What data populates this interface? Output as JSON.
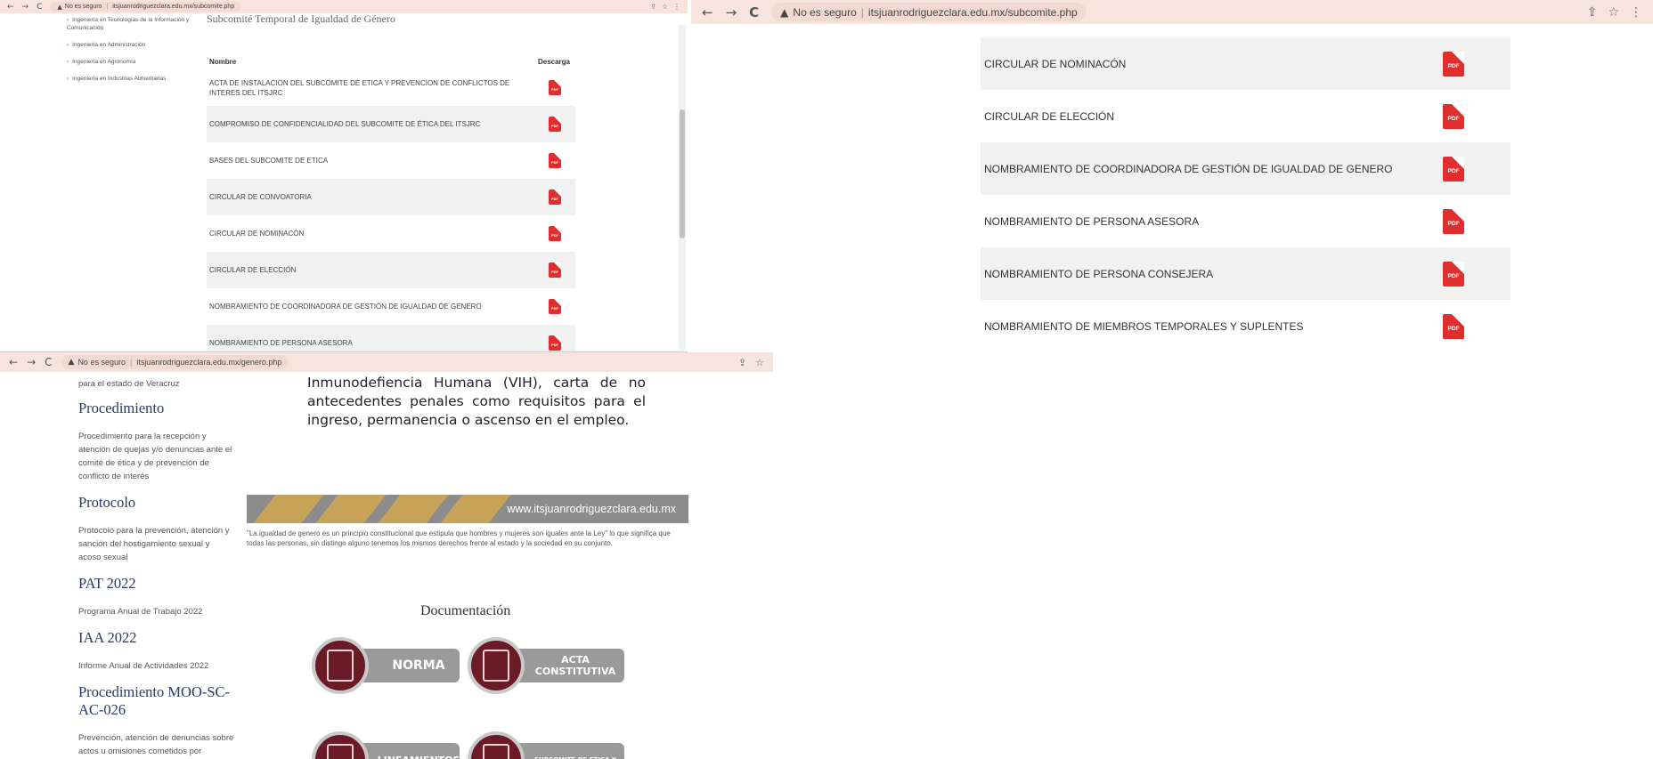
{
  "winA": {
    "url_warning": "No es seguro",
    "url": "itsjuanrodriguezclara.edu.mx/subcomite.php",
    "heading_partial": "Subcomité Temporal de Igualdad de Género",
    "sidebar": [
      "Ingeniería en Tecnologías de la Información y Comunicación",
      "Ingeniería en Administración",
      "Ingeniería en Agronomía",
      "Ingeniería en Industrias Alimentarias"
    ],
    "table": {
      "col_name": "Nombre",
      "col_download": "Descarga",
      "rows": [
        "ACTA DE INSTALACION DEL SUBCOMITE DE ETICA Y PREVENCION DE CONFLICTOS DE INTERES DEL ITSJRC",
        "COMPROMISO DE CONFIDENCIALIDAD DEL SUBCOMITE DE ÉTICA DEL ITSJRC",
        "BASES DEL SUBCOMITE DE ETICA",
        "CIRCULAR DE CONVOATORIA",
        "CIRCULAR DE NOMINACÓN",
        "CIRCULAR DE ELECCIÓN",
        "NOMBRAMIENTO DE COORDINADORA DE GESTIÓN DE IGUALDAD DE GENERO",
        "NOMBRAMIENTO DE PERSONA ASESORA"
      ]
    }
  },
  "winB": {
    "url_warning": "No es seguro",
    "url": "itsjuanrodriguezclara.edu.mx/subcomite.php",
    "rows": [
      "CIRCULAR DE NOMINACÓN",
      "CIRCULAR DE ELECCIÓN",
      "NOMBRAMIENTO DE COORDINADORA DE GESTIÓN DE IGUALDAD DE GENERO",
      "NOMBRAMIENTO DE PERSONA ASESORA",
      "NOMBRAMIENTO DE PERSONA CONSEJERA",
      "NOMBRAMIENTO DE MIEMBROS TEMPORALES Y SUPLENTES"
    ]
  },
  "winC": {
    "url_warning": "No es seguro",
    "url": "itsjuanrodriguezclara.edu.mx/genero.php",
    "sidebar_top": "para el estado de Veracruz",
    "sections": [
      {
        "title": "Procedimiento",
        "text": "Procedimiento para la recepción y atención de quejas y/o denuncias ante el comité de ética y de prevención de conflicto de interés"
      },
      {
        "title": "Protocolo",
        "text": "Protocolo para la prevención, atención y sanción del hostigamiento sexual y acoso sexual"
      },
      {
        "title": "PAT 2022",
        "text": "Programa Anual de Trabajo 2022"
      },
      {
        "title": "IAA 2022",
        "text": "Informe Anual de Actividades 2022"
      },
      {
        "title": "Procedimiento MOO-SC-AC-026",
        "text": "Prevención, atención de denuncias sobre actos u omisiones cometidos por servidoras y servidores públicos en contra de las normas éticas que"
      }
    ],
    "paragraph": "Inmunodefiencia Humana (VIH), carta de no antecedentes penales como requisitos para el ingreso, permanencia o ascenso en el empleo.",
    "banner_url": "www.itsjuanrodriguezclara.edu.mx",
    "quote": "\"La igualdad de genero es un principio constitucional que estipula que hombres y mujeres son iguales ante la Ley\" lo que significa que todas las personas, sin distingo alguno tenemos los mismos derechos frente al estado y la sociedad en su conjunto.",
    "doc_title": "Documentación",
    "buttons": [
      "NORMA",
      "ACTA CONSTITUTIVA",
      "LINEAMIENTOS",
      "SUBCOMITE DE ETICA Y"
    ]
  },
  "icons": {
    "back": "←",
    "forward": "→",
    "reload": "C",
    "warning": "▲",
    "share": "⇪",
    "star": "☆",
    "menu": "⋮",
    "pdf": "PDF"
  },
  "colors": {
    "pdf_red": "#e02e2e",
    "button_circle": "#6b1a27",
    "heading_navy": "#2b3a67"
  }
}
